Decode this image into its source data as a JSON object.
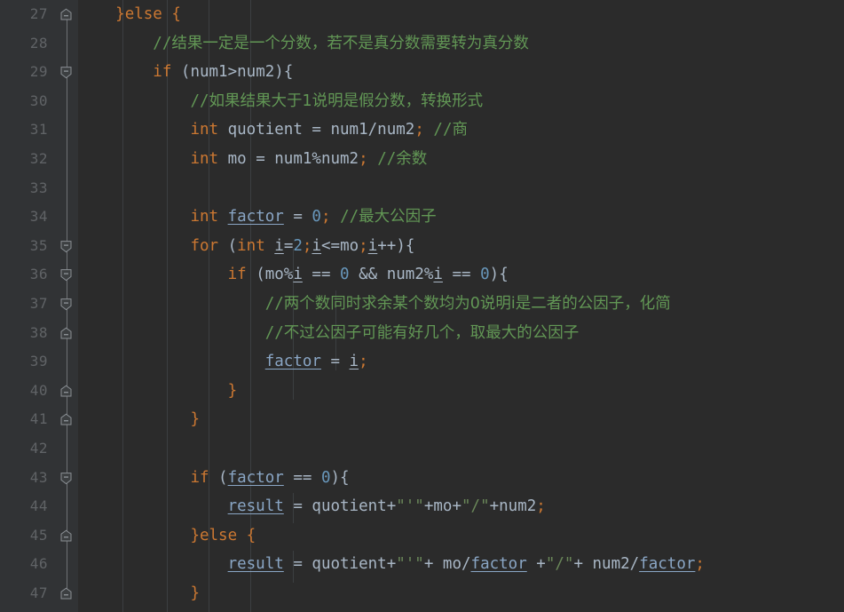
{
  "editor": {
    "app": "code-editor",
    "theme": "darcula",
    "colors": {
      "background": "#2b2b2b",
      "gutter_background": "#313335",
      "line_number": "#606366",
      "keyword": "#cc7832",
      "number": "#6897bb",
      "string": "#6a8759",
      "comment": "#629755",
      "identifier": "#a9b7c6",
      "field_reference": "#8aa6c5",
      "indent_guide": "#3c3f41"
    },
    "first_visible_line": 27,
    "last_visible_line": 47
  },
  "gutter": {
    "line_numbers": [
      27,
      28,
      29,
      30,
      31,
      32,
      33,
      34,
      35,
      36,
      37,
      38,
      39,
      40,
      41,
      42,
      43,
      44,
      45,
      46,
      47
    ],
    "fold_markers": [
      {
        "line": 27,
        "type": "fold-end",
        "icon": "fold-end-icon"
      },
      {
        "line": 29,
        "type": "fold-start",
        "icon": "fold-start-icon"
      },
      {
        "line": 35,
        "type": "fold-start",
        "icon": "fold-start-icon"
      },
      {
        "line": 36,
        "type": "fold-start",
        "icon": "fold-start-icon"
      },
      {
        "line": 37,
        "type": "fold-start",
        "icon": "fold-start-icon"
      },
      {
        "line": 38,
        "type": "fold-end",
        "icon": "fold-end-icon"
      },
      {
        "line": 40,
        "type": "fold-end",
        "icon": "fold-end-icon"
      },
      {
        "line": 41,
        "type": "fold-end",
        "icon": "fold-end-icon"
      },
      {
        "line": 43,
        "type": "fold-start",
        "icon": "fold-start-icon"
      },
      {
        "line": 45,
        "type": "fold-end",
        "icon": "fold-end-icon"
      },
      {
        "line": 47,
        "type": "fold-end",
        "icon": "fold-end-icon"
      }
    ]
  },
  "code": {
    "language": "java",
    "lines": [
      {
        "number": 27,
        "text": "    }else {",
        "tokens": [
          {
            "t": "    ",
            "c": "txt"
          },
          {
            "t": "}",
            "c": "brace"
          },
          {
            "t": "else",
            "c": "kw"
          },
          {
            "t": " {",
            "c": "brace"
          }
        ]
      },
      {
        "number": 28,
        "text": "        //结果一定是一个分数，若不是真分数需要转为真分数",
        "tokens": [
          {
            "t": "        ",
            "c": "txt"
          },
          {
            "t": "//",
            "c": "cmt"
          },
          {
            "t": "结果一定是一个分数，若不是真分数需要转为真分数",
            "c": "cmt-cjk"
          }
        ]
      },
      {
        "number": 29,
        "text": "        if (num1>num2){",
        "tokens": [
          {
            "t": "        ",
            "c": "txt"
          },
          {
            "t": "if",
            "c": "kw"
          },
          {
            "t": " (num1>num2){",
            "c": "txt"
          }
        ]
      },
      {
        "number": 30,
        "text": "            //如果结果大于1说明是假分数，转换形式",
        "tokens": [
          {
            "t": "            ",
            "c": "txt"
          },
          {
            "t": "//",
            "c": "cmt"
          },
          {
            "t": "如果结果大于1说明是假分数，转换形式",
            "c": "cmt-cjk"
          }
        ]
      },
      {
        "number": 31,
        "text": "            int quotient = num1/num2; //商",
        "tokens": [
          {
            "t": "            ",
            "c": "txt"
          },
          {
            "t": "int",
            "c": "kw"
          },
          {
            "t": " quotient = num1/num2",
            "c": "txt"
          },
          {
            "t": ";",
            "c": "semi"
          },
          {
            "t": " ",
            "c": "txt"
          },
          {
            "t": "//",
            "c": "cmt"
          },
          {
            "t": "商",
            "c": "cmt-cjk"
          }
        ]
      },
      {
        "number": 32,
        "text": "            int mo = num1%num2; //余数",
        "tokens": [
          {
            "t": "            ",
            "c": "txt"
          },
          {
            "t": "int",
            "c": "kw"
          },
          {
            "t": " mo = num1%num2",
            "c": "txt"
          },
          {
            "t": ";",
            "c": "semi"
          },
          {
            "t": " ",
            "c": "txt"
          },
          {
            "t": "//",
            "c": "cmt"
          },
          {
            "t": "余数",
            "c": "cmt-cjk"
          }
        ]
      },
      {
        "number": 33,
        "text": "",
        "tokens": []
      },
      {
        "number": 34,
        "text": "            int factor = 0; //最大公因子",
        "tokens": [
          {
            "t": "            ",
            "c": "txt"
          },
          {
            "t": "int",
            "c": "kw"
          },
          {
            "t": " ",
            "c": "txt"
          },
          {
            "t": "factor",
            "c": "fldblue"
          },
          {
            "t": " = ",
            "c": "txt"
          },
          {
            "t": "0",
            "c": "num"
          },
          {
            "t": ";",
            "c": "semi"
          },
          {
            "t": " ",
            "c": "txt"
          },
          {
            "t": "//",
            "c": "cmt"
          },
          {
            "t": "最大公因子",
            "c": "cmt-cjk"
          }
        ]
      },
      {
        "number": 35,
        "text": "            for (int i=2;i<=mo;i++){",
        "tokens": [
          {
            "t": "            ",
            "c": "txt"
          },
          {
            "t": "for",
            "c": "kw"
          },
          {
            "t": " (",
            "c": "txt"
          },
          {
            "t": "int",
            "c": "kw"
          },
          {
            "t": " ",
            "c": "txt"
          },
          {
            "t": "i",
            "c": "var-u"
          },
          {
            "t": "=",
            "c": "txt"
          },
          {
            "t": "2",
            "c": "num"
          },
          {
            "t": ";",
            "c": "semi"
          },
          {
            "t": "i",
            "c": "var-u"
          },
          {
            "t": "<=mo",
            "c": "txt"
          },
          {
            "t": ";",
            "c": "semi"
          },
          {
            "t": "i",
            "c": "var-u"
          },
          {
            "t": "++){",
            "c": "txt"
          }
        ]
      },
      {
        "number": 36,
        "text": "                if (mo%i == 0 && num2%i == 0){",
        "tokens": [
          {
            "t": "                ",
            "c": "txt"
          },
          {
            "t": "if",
            "c": "kw"
          },
          {
            "t": " (mo%",
            "c": "txt"
          },
          {
            "t": "i",
            "c": "var-u"
          },
          {
            "t": " == ",
            "c": "txt"
          },
          {
            "t": "0",
            "c": "num"
          },
          {
            "t": " && num2%",
            "c": "txt"
          },
          {
            "t": "i",
            "c": "var-u"
          },
          {
            "t": " == ",
            "c": "txt"
          },
          {
            "t": "0",
            "c": "num"
          },
          {
            "t": "){",
            "c": "txt"
          }
        ]
      },
      {
        "number": 37,
        "text": "                    //两个数同时求余某个数均为0说明i是二者的公因子，化简",
        "tokens": [
          {
            "t": "                    ",
            "c": "txt"
          },
          {
            "t": "//",
            "c": "cmt"
          },
          {
            "t": "两个数同时求余某个数均为0说明i是二者的公因子，化简",
            "c": "cmt-cjk"
          }
        ]
      },
      {
        "number": 38,
        "text": "                    //不过公因子可能有好几个，取最大的公因子",
        "tokens": [
          {
            "t": "                    ",
            "c": "txt"
          },
          {
            "t": "//",
            "c": "cmt"
          },
          {
            "t": "不过公因子可能有好几个，取最大的公因子",
            "c": "cmt-cjk"
          }
        ]
      },
      {
        "number": 39,
        "text": "                    factor = i;",
        "tokens": [
          {
            "t": "                    ",
            "c": "txt"
          },
          {
            "t": "factor",
            "c": "fldblue"
          },
          {
            "t": " = ",
            "c": "txt"
          },
          {
            "t": "i",
            "c": "var-u"
          },
          {
            "t": ";",
            "c": "semi"
          }
        ]
      },
      {
        "number": 40,
        "text": "                }",
        "tokens": [
          {
            "t": "                ",
            "c": "txt"
          },
          {
            "t": "}",
            "c": "brace"
          }
        ]
      },
      {
        "number": 41,
        "text": "            }",
        "tokens": [
          {
            "t": "            ",
            "c": "txt"
          },
          {
            "t": "}",
            "c": "brace"
          }
        ]
      },
      {
        "number": 42,
        "text": "",
        "tokens": []
      },
      {
        "number": 43,
        "text": "            if (factor == 0){",
        "tokens": [
          {
            "t": "            ",
            "c": "txt"
          },
          {
            "t": "if",
            "c": "kw"
          },
          {
            "t": " (",
            "c": "txt"
          },
          {
            "t": "factor",
            "c": "fldblue"
          },
          {
            "t": " == ",
            "c": "txt"
          },
          {
            "t": "0",
            "c": "num"
          },
          {
            "t": "){",
            "c": "txt"
          }
        ]
      },
      {
        "number": 44,
        "text": "                result = quotient+\"'\"+mo+\"/\"+num2;",
        "tokens": [
          {
            "t": "                ",
            "c": "txt"
          },
          {
            "t": "result",
            "c": "fldblue"
          },
          {
            "t": " = quotient+",
            "c": "txt"
          },
          {
            "t": "\"'\"",
            "c": "str"
          },
          {
            "t": "+mo+",
            "c": "txt"
          },
          {
            "t": "\"/\"",
            "c": "str"
          },
          {
            "t": "+num2",
            "c": "txt"
          },
          {
            "t": ";",
            "c": "semi"
          }
        ]
      },
      {
        "number": 45,
        "text": "            }else {",
        "tokens": [
          {
            "t": "            ",
            "c": "txt"
          },
          {
            "t": "}",
            "c": "brace"
          },
          {
            "t": "else",
            "c": "kw"
          },
          {
            "t": " {",
            "c": "brace"
          }
        ]
      },
      {
        "number": 46,
        "text": "                result = quotient+\"'\"+ mo/factor +\"/\"+ num2/factor;",
        "tokens": [
          {
            "t": "                ",
            "c": "txt"
          },
          {
            "t": "result",
            "c": "fldblue"
          },
          {
            "t": " = quotient+",
            "c": "txt"
          },
          {
            "t": "\"'\"",
            "c": "str"
          },
          {
            "t": "+ mo/",
            "c": "txt"
          },
          {
            "t": "factor",
            "c": "fldblue"
          },
          {
            "t": " +",
            "c": "txt"
          },
          {
            "t": "\"/\"",
            "c": "str"
          },
          {
            "t": "+ num2/",
            "c": "txt"
          },
          {
            "t": "factor",
            "c": "fldblue"
          },
          {
            "t": ";",
            "c": "semi"
          }
        ]
      },
      {
        "number": 47,
        "text": "            }",
        "tokens": [
          {
            "t": "            ",
            "c": "txt"
          },
          {
            "t": "}",
            "c": "brace"
          }
        ]
      }
    ]
  },
  "indent_guides": {
    "columns": [
      50,
      100,
      147,
      194
    ],
    "note": "vertical indent guide lines in code area"
  }
}
